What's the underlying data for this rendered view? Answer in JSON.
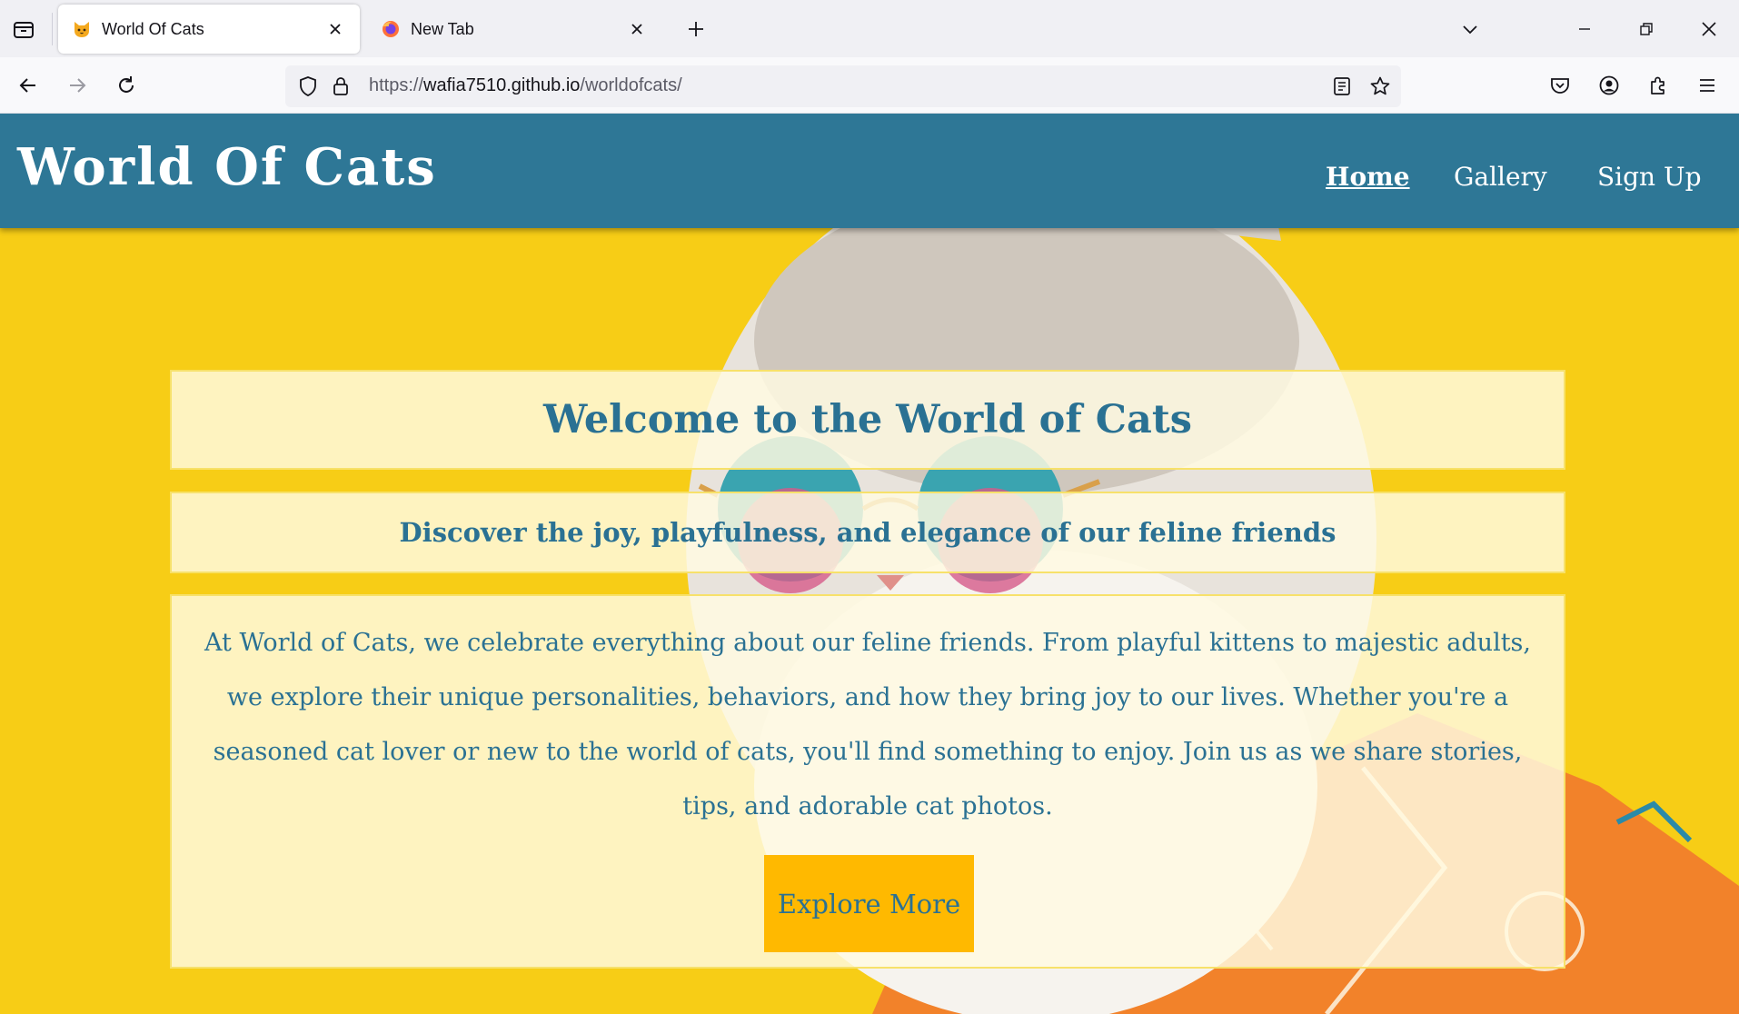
{
  "browser": {
    "tabs": [
      {
        "title": "World Of Cats",
        "favicon": "cat-face-icon",
        "active": true
      },
      {
        "title": "New Tab",
        "favicon": "firefox-icon",
        "active": false
      }
    ],
    "url": {
      "scheme": "https://",
      "host": "wafia7510.github.io",
      "path": "/worldofcats/"
    }
  },
  "site": {
    "title": "World Of Cats",
    "nav": [
      "Home",
      "Gallery",
      "Sign Up"
    ],
    "active_nav": "Home",
    "colors": {
      "header": "#2e7796",
      "background": "#f7cd16",
      "text": "#2a7193",
      "button": "#ffb900"
    }
  },
  "hero": {
    "heading": "Welcome to the World of Cats",
    "tagline": "Discover the joy, playfulness, and elegance of our feline friends",
    "body": "At World of Cats, we celebrate everything about our feline friends. From playful kittens to majestic adults, we explore their unique personalities, behaviors, and how they bring joy to our lives. Whether you're a seasoned cat lover or new to the world of cats, you'll find something to enjoy. Join us as we share stories, tips, and adorable cat photos.",
    "cta": "Explore More"
  }
}
